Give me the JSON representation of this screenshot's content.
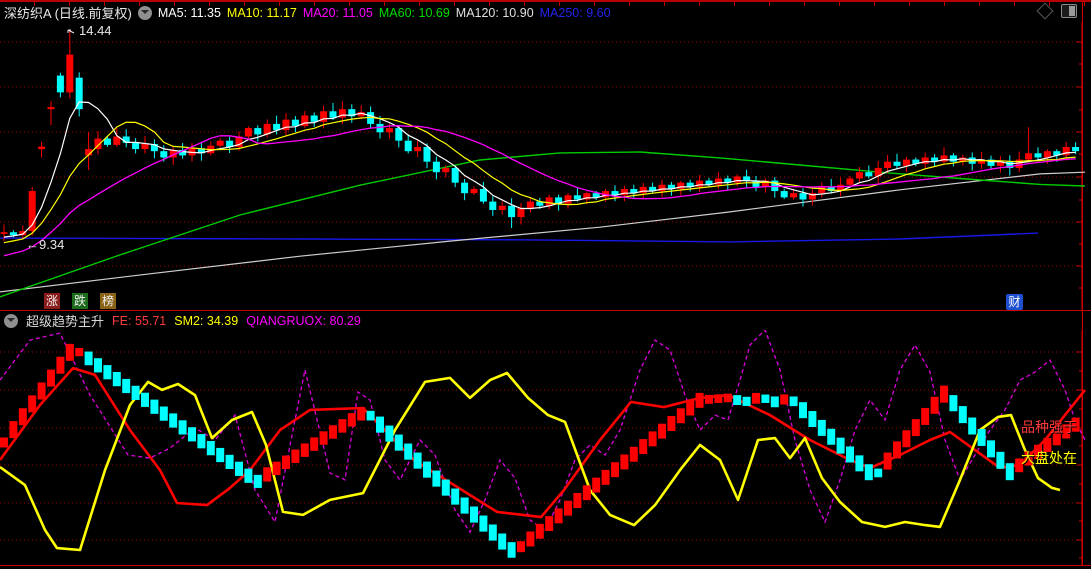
{
  "header": {
    "symbol": "深纺织A",
    "period": "(日线.前复权)",
    "ma_items": [
      {
        "label": "MA5:",
        "value": "11.35",
        "color": "#ffffff"
      },
      {
        "label": "MA10:",
        "value": "11.17",
        "color": "#ffff00"
      },
      {
        "label": "MA20:",
        "value": "11.05",
        "color": "#ff00ff"
      },
      {
        "label": "MA60:",
        "value": "10.69",
        "color": "#00dd00"
      },
      {
        "label": "MA120:",
        "value": "10.90",
        "color": "#e0e0e0"
      },
      {
        "label": "MA250:",
        "value": "9.60",
        "color": "#2222ee"
      }
    ]
  },
  "main_chart": {
    "high_annotation": "14.44",
    "low_annotation": "9.34",
    "quick_buttons": [
      {
        "label": "涨",
        "bg": "#8b1c1c"
      },
      {
        "label": "跌",
        "bg": "#1d6b1d"
      },
      {
        "label": "榜",
        "bg": "#8a6216"
      }
    ],
    "cai_badge": "财"
  },
  "indicator": {
    "name": "超级趋势主升",
    "items": [
      {
        "label": "FE:",
        "value": "55.71",
        "color": "#ff3b3b"
      },
      {
        "label": "SM2:",
        "value": "34.39",
        "color": "#ffff00"
      },
      {
        "label": "QIANGRUOX:",
        "value": "80.29",
        "color": "#ff00ff"
      }
    ],
    "side_texts": [
      {
        "text": "品种强于",
        "color": "#ff3b3b"
      },
      {
        "text": "大盘处在",
        "color": "#ffff00"
      }
    ]
  },
  "chart_data": [
    {
      "type": "candlestick",
      "title": "深纺织A 日线 前复权",
      "ylim": [
        7.8,
        14.6
      ],
      "grid": true,
      "high_label": 14.44,
      "low_label": 9.34,
      "open0": 9.58,
      "closes": [
        9.62,
        9.55,
        9.65,
        10.6,
        11.66,
        12.6,
        12.95,
        13.85,
        12.55,
        11.6,
        11.85,
        11.7,
        11.9,
        11.75,
        11.6,
        11.72,
        11.55,
        11.4,
        11.58,
        11.45,
        11.62,
        11.5,
        11.68,
        11.8,
        11.65,
        11.9,
        12.1,
        11.95,
        12.2,
        12.05,
        12.3,
        12.15,
        12.4,
        12.25,
        12.5,
        12.35,
        12.55,
        12.38,
        12.48,
        12.2,
        12.0,
        12.1,
        11.8,
        11.55,
        11.65,
        11.3,
        11.05,
        11.15,
        10.8,
        10.55,
        10.65,
        10.35,
        10.15,
        10.25,
        9.98,
        10.2,
        10.35,
        10.25,
        10.45,
        10.3,
        10.5,
        10.4,
        10.55,
        10.45,
        10.6,
        10.5,
        10.65,
        10.55,
        10.7,
        10.6,
        10.75,
        10.65,
        10.8,
        10.7,
        10.85,
        10.75,
        10.9,
        10.8,
        10.95,
        10.85,
        10.7,
        10.85,
        10.6,
        10.45,
        10.55,
        10.4,
        10.55,
        10.7,
        10.6,
        10.75,
        10.9,
        11.05,
        10.95,
        11.15,
        11.3,
        11.2,
        11.35,
        11.25,
        11.4,
        11.3,
        11.45,
        11.3,
        11.4,
        11.25,
        11.35,
        11.2,
        11.3,
        11.15,
        11.35,
        11.5,
        11.4,
        11.55,
        11.45,
        11.65,
        11.55
      ],
      "prehistory": [
        8.4,
        8.45,
        8.52,
        8.58,
        8.65,
        8.72,
        8.78,
        8.85,
        8.92,
        8.98,
        9.05,
        9.12,
        9.18,
        9.25,
        9.3,
        9.35,
        9.4,
        9.45,
        9.5,
        9.55
      ],
      "open_overrides": {
        "4": 11.6,
        "5": 12.55,
        "6": 13.35,
        "8": 13.3,
        "9": 11.45
      },
      "wick_overrides": {
        "4": {
          "l": 11.4
        },
        "5": {
          "l": 12.17
        },
        "7": {
          "h": 14.44
        },
        "9": {
          "h": 12.0,
          "l": 11.1
        },
        "54": {
          "l": 9.72
        },
        "109": {
          "h": 12.12
        }
      },
      "up_color": "#ff0000",
      "down_color": "#00ffff",
      "ma_colors": {
        "ma5": "#ffffff",
        "ma10": "#ffff00",
        "ma20": "#ff00ff",
        "ma60": "#00cc00",
        "ma120": "#cfcfcf",
        "ma250": "#1717e8"
      },
      "ma60": [
        [
          0,
          8.08
        ],
        [
          120,
          9.08
        ],
        [
          240,
          10.03
        ],
        [
          360,
          10.74
        ],
        [
          480,
          11.34
        ],
        [
          560,
          11.51
        ],
        [
          640,
          11.53
        ],
        [
          720,
          11.39
        ],
        [
          800,
          11.22
        ],
        [
          880,
          11.05
        ],
        [
          960,
          10.9
        ],
        [
          1040,
          10.76
        ],
        [
          1085,
          10.72
        ]
      ],
      "ma120": [
        [
          0,
          8.2
        ],
        [
          150,
          8.63
        ],
        [
          300,
          9.05
        ],
        [
          450,
          9.41
        ],
        [
          600,
          9.74
        ],
        [
          728,
          10.1
        ],
        [
          900,
          10.63
        ],
        [
          1040,
          11.01
        ],
        [
          1085,
          11.05
        ]
      ],
      "ma250": [
        [
          0,
          9.48
        ],
        [
          300,
          9.46
        ],
        [
          520,
          9.44
        ],
        [
          730,
          9.39
        ],
        [
          900,
          9.46
        ],
        [
          1038,
          9.6
        ]
      ]
    },
    {
      "type": "line",
      "title": "超级趋势主升",
      "ylim": [
        0,
        100
      ],
      "grid": true,
      "series": [
        {
          "name": "trend-blocks",
          "style": "blocks",
          "up_color": "#ff0000",
          "down_color": "#00ffff",
          "points": [
            [
              0,
              49.8
            ],
            [
              70,
              90.6
            ],
            [
              80,
              90.6
            ],
            [
              257,
              35.3
            ],
            [
              263,
              37.4
            ],
            [
              364,
              65.1
            ],
            [
              370,
              63.8
            ],
            [
              511,
              6.4
            ],
            [
              517,
              6.4
            ],
            [
              700,
              70.2
            ],
            [
              728,
              71.1
            ],
            [
              745,
              69.4
            ],
            [
              760,
              71.5
            ],
            [
              775,
              69.4
            ],
            [
              790,
              71.1
            ],
            [
              875,
              37.0
            ],
            [
              880,
              40.4
            ],
            [
              945,
              73.2
            ],
            [
              1010,
              39.6
            ],
            [
              1085,
              62.6
            ]
          ]
        },
        {
          "name": "FE",
          "style": "thick",
          "color": "#ff0000",
          "points": [
            [
              0,
              44.7
            ],
            [
              40,
              68.1
            ],
            [
              73,
              83.8
            ],
            [
              95,
              80.9
            ],
            [
              130,
              57.4
            ],
            [
              160,
              40.4
            ],
            [
              177,
              26.4
            ],
            [
              207,
              25.5
            ],
            [
              230,
              32.8
            ],
            [
              250,
              40.4
            ],
            [
              280,
              57.4
            ],
            [
              310,
              66.0
            ],
            [
              363,
              66.8
            ],
            [
              414,
              44.7
            ],
            [
              497,
              22.6
            ],
            [
              541,
              20.4
            ],
            [
              564,
              31.9
            ],
            [
              600,
              53.2
            ],
            [
              631,
              69.4
            ],
            [
              664,
              67.2
            ],
            [
              700,
              71.1
            ],
            [
              728,
              72.3
            ],
            [
              770,
              63.8
            ],
            [
              810,
              53.2
            ],
            [
              850,
              44.7
            ],
            [
              870,
              41.3
            ],
            [
              900,
              46.8
            ],
            [
              930,
              53.2
            ],
            [
              950,
              56.6
            ],
            [
              975,
              48.9
            ],
            [
              1000,
              41.3
            ],
            [
              1020,
              42.6
            ],
            [
              1045,
              53.2
            ],
            [
              1065,
              63.8
            ],
            [
              1085,
              74.5
            ]
          ]
        },
        {
          "name": "SM2",
          "style": "thick",
          "color": "#ffff00",
          "points": [
            [
              0,
              41.7
            ],
            [
              25,
              34.0
            ],
            [
              45,
              14.9
            ],
            [
              57,
              7.2
            ],
            [
              80,
              6.4
            ],
            [
              105,
              40.4
            ],
            [
              130,
              68.1
            ],
            [
              148,
              77.9
            ],
            [
              162,
              74.5
            ],
            [
              178,
              77.0
            ],
            [
              195,
              72.3
            ],
            [
              212,
              54.0
            ],
            [
              232,
              61.7
            ],
            [
              252,
              65.1
            ],
            [
              266,
              51.1
            ],
            [
              283,
              22.6
            ],
            [
              303,
              21.3
            ],
            [
              330,
              27.7
            ],
            [
              363,
              30.6
            ],
            [
              395,
              57.4
            ],
            [
              425,
              77.9
            ],
            [
              450,
              79.6
            ],
            [
              470,
              71.1
            ],
            [
              490,
              78.7
            ],
            [
              507,
              81.7
            ],
            [
              528,
              71.1
            ],
            [
              548,
              63.8
            ],
            [
              565,
              60.9
            ],
            [
              590,
              31.9
            ],
            [
              610,
              21.3
            ],
            [
              634,
              17.0
            ],
            [
              655,
              25.5
            ],
            [
              680,
              40.4
            ],
            [
              700,
              51.1
            ],
            [
              720,
              44.7
            ],
            [
              738,
              27.7
            ],
            [
              758,
              53.2
            ],
            [
              775,
              54.0
            ],
            [
              790,
              45.5
            ],
            [
              805,
              54.0
            ],
            [
              822,
              37.0
            ],
            [
              840,
              26.8
            ],
            [
              862,
              18.3
            ],
            [
              885,
              16.2
            ],
            [
              905,
              18.3
            ],
            [
              925,
              17.0
            ],
            [
              940,
              16.2
            ],
            [
              960,
              36.2
            ],
            [
              980,
              57.4
            ],
            [
              998,
              63.0
            ],
            [
              1011,
              63.8
            ],
            [
              1025,
              48.9
            ],
            [
              1038,
              37.0
            ],
            [
              1052,
              32.8
            ],
            [
              1060,
              31.9
            ]
          ]
        },
        {
          "name": "QIANGRUOX",
          "style": "dashed",
          "color": "#dd00dd",
          "points": [
            [
              0,
              78.7
            ],
            [
              30,
              95.7
            ],
            [
              60,
              98.7
            ],
            [
              90,
              72.3
            ],
            [
              128,
              46.8
            ],
            [
              150,
              45.5
            ],
            [
              170,
              49.8
            ],
            [
              195,
              58.3
            ],
            [
              215,
              53.2
            ],
            [
              235,
              63.8
            ],
            [
              255,
              31.9
            ],
            [
              275,
              18.3
            ],
            [
              295,
              61.7
            ],
            [
              305,
              83.0
            ],
            [
              330,
              39.1
            ],
            [
              345,
              36.2
            ],
            [
              358,
              73.6
            ],
            [
              370,
              70.2
            ],
            [
              385,
              44.7
            ],
            [
              400,
              36.2
            ],
            [
              420,
              53.2
            ],
            [
              435,
              46.8
            ],
            [
              455,
              23.4
            ],
            [
              470,
              14.0
            ],
            [
              485,
              27.7
            ],
            [
              500,
              44.7
            ],
            [
              515,
              37.0
            ],
            [
              530,
              19.1
            ],
            [
              545,
              14.9
            ],
            [
              560,
              27.7
            ],
            [
              575,
              44.7
            ],
            [
              590,
              51.1
            ],
            [
              605,
              46.8
            ],
            [
              620,
              57.4
            ],
            [
              640,
              83.0
            ],
            [
              655,
              95.7
            ],
            [
              670,
              91.5
            ],
            [
              685,
              72.3
            ],
            [
              700,
              57.4
            ],
            [
              715,
              63.8
            ],
            [
              728,
              61.7
            ],
            [
              740,
              78.7
            ],
            [
              750,
              93.6
            ],
            [
              765,
              100.0
            ],
            [
              780,
              83.0
            ],
            [
              795,
              53.2
            ],
            [
              810,
              31.9
            ],
            [
              825,
              18.3
            ],
            [
              840,
              36.2
            ],
            [
              855,
              57.4
            ],
            [
              870,
              70.2
            ],
            [
              885,
              61.7
            ],
            [
              900,
              83.0
            ],
            [
              915,
              93.6
            ],
            [
              930,
              82.1
            ],
            [
              945,
              53.2
            ],
            [
              960,
              36.2
            ],
            [
              975,
              46.8
            ],
            [
              990,
              57.4
            ],
            [
              1005,
              66.0
            ],
            [
              1020,
              78.7
            ],
            [
              1035,
              82.1
            ],
            [
              1050,
              87.2
            ],
            [
              1065,
              74.5
            ],
            [
              1075,
              61.7
            ],
            [
              1085,
              53.2
            ]
          ]
        }
      ]
    }
  ]
}
